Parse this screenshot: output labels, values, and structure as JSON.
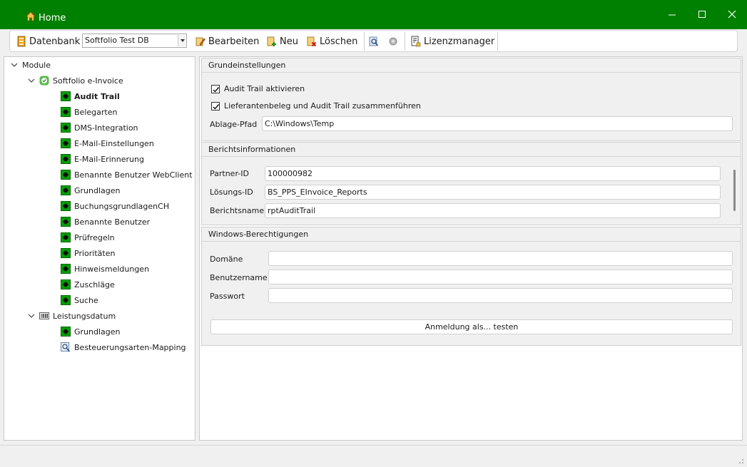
{
  "window": {
    "title": "Home",
    "accent_color": "#008000"
  },
  "toolbar": {
    "database_label": "Datenbank",
    "database_value": "Softfolio Test DB",
    "edit_label": "Bearbeiten",
    "new_label": "Neu",
    "delete_label": "Löschen",
    "license_label": "Lizenzmanager"
  },
  "tree": {
    "root": "Module",
    "groups": [
      {
        "label": "Softfolio e-Invoice",
        "icon": "check-circle-icon",
        "items": [
          "Audit Trail",
          "Belegarten",
          "DMS-Integration",
          "E-Mail-Einstellungen",
          "E-Mail-Erinnerung",
          "Benannte Benutzer WebClient",
          "Grundlagen",
          "BuchungsgrundlagenCH",
          "Benannte Benutzer",
          "Prüfregeln",
          "Prioritäten",
          "Hinweismeldungen",
          "Zuschläge",
          "Suche"
        ],
        "selected": "Audit Trail"
      },
      {
        "label": "Leistungsdatum",
        "icon": "barcode-icon",
        "items": [
          "Grundlagen",
          "Besteuerungsarten-Mapping"
        ]
      }
    ]
  },
  "grundeinstellungen": {
    "header": "Grundeinstellungen",
    "checkbox_audit": "Audit Trail aktivieren",
    "checkbox_audit_checked": true,
    "checkbox_merge": "Lieferantenbeleg und Audit Trail zusammenführen",
    "checkbox_merge_checked": true,
    "path_label": "Ablage-Pfad",
    "path_value": "C:\\Windows\\Temp"
  },
  "berichtsinformationen": {
    "header": "Berichtsinformationen",
    "partner_label": "Partner-ID",
    "partner_value": "100000982",
    "solution_label": "Lösungs-ID",
    "solution_value": "BS_PPS_EInvoice_Reports",
    "report_label": "Berichtsname",
    "report_value": "rptAuditTrail"
  },
  "windows_berechtigungen": {
    "header": "Windows-Berechtigungen",
    "domain_label": "Domäne",
    "domain_value": "",
    "user_label": "Benutzername",
    "user_value": "",
    "password_label": "Passwort",
    "password_value": "",
    "test_button": "Anmeldung als... testen"
  }
}
